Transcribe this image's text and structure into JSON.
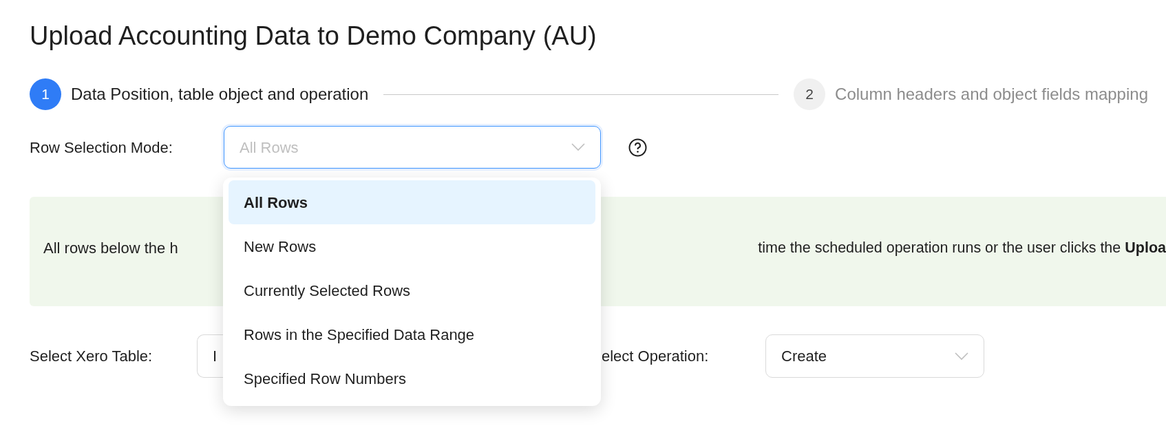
{
  "title": "Upload Accounting Data to Demo Company (AU)",
  "steps": [
    {
      "number": "1",
      "label": "Data Position, table object and operation",
      "selected": true
    },
    {
      "number": "2",
      "label": "Column headers and object fields mapping",
      "selected": false
    }
  ],
  "row_selection": {
    "label": "Row Selection Mode:",
    "placeholder": "All Rows",
    "expanded": true,
    "options": [
      {
        "label": "All Rows",
        "selected": true
      },
      {
        "label": "New Rows",
        "selected": false
      },
      {
        "label": "Currently Selected Rows",
        "selected": false
      },
      {
        "label": "Rows in the Specified Data Range",
        "selected": false
      },
      {
        "label": "Specified Row Numbers",
        "selected": false
      }
    ]
  },
  "info_box": {
    "text_start": "All rows below the h",
    "text_end": "time the scheduled operation runs or the user clicks the **Uploa**"
  },
  "table_select": {
    "label": "Select Xero Table:",
    "value": "I"
  },
  "operation_select": {
    "label": "elect Operation:",
    "value": "Create"
  }
}
